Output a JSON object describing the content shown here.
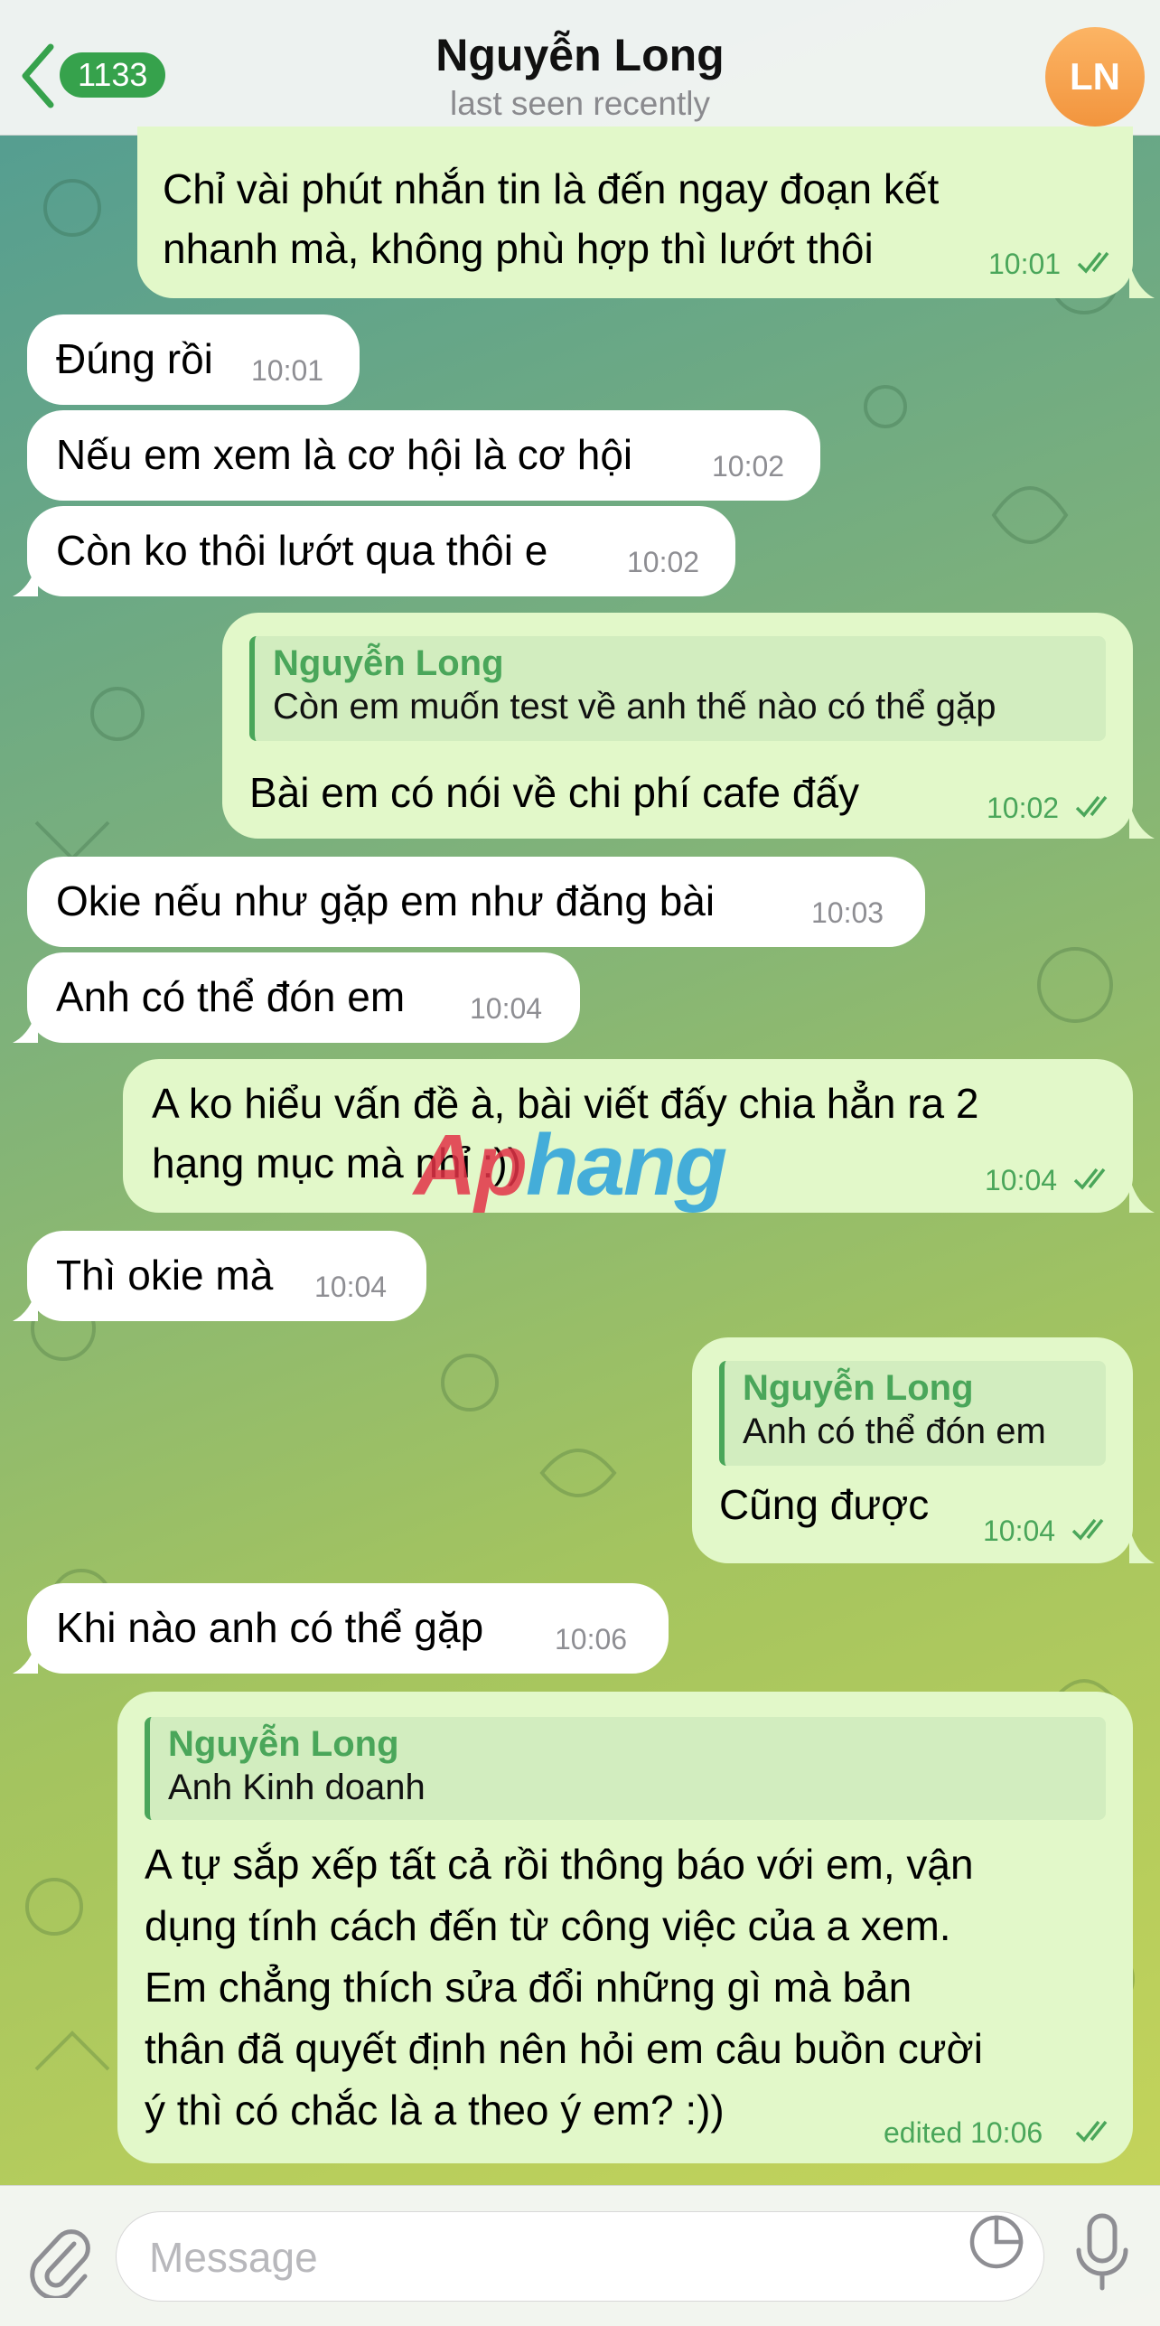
{
  "header": {
    "back_count": "1133",
    "title": "Nguyễn Long",
    "subtitle": "last seen recently",
    "avatar_initials": "LN",
    "avatar_color": "#f4a04a"
  },
  "messages": [
    {
      "dir": "out",
      "text": [
        "Chỉ vài phút nhắn tin là đến ngay đoạn kết",
        "nhanh mà, không phù hợp thì lướt thôi"
      ],
      "time": "10:01",
      "read": true
    },
    {
      "dir": "in",
      "text": [
        "Đúng rồi"
      ],
      "time": "10:01"
    },
    {
      "dir": "in",
      "text": [
        "Nếu em xem là cơ hội là cơ hội"
      ],
      "time": "10:02"
    },
    {
      "dir": "in",
      "text": [
        "Còn ko thôi lướt qua thôi e"
      ],
      "time": "10:02"
    },
    {
      "dir": "out",
      "reply_name": "Nguyễn Long",
      "reply_text": "Còn em muốn test về anh thế nào có thể gặp",
      "text": [
        "Bài em có nói về chi phí cafe đấy"
      ],
      "time": "10:02",
      "read": true
    },
    {
      "dir": "in",
      "text": [
        "Okie nếu như gặp em như đăng bài"
      ],
      "time": "10:03"
    },
    {
      "dir": "in",
      "text": [
        "Anh có thể đón em"
      ],
      "time": "10:04"
    },
    {
      "dir": "out",
      "text": [
        "A ko hiểu vấn đề à, bài viết đấy chia hẳn ra 2",
        "hạng mục mà nhỉ :))"
      ],
      "time": "10:04",
      "read": true
    },
    {
      "dir": "in",
      "text": [
        "Thì okie mà"
      ],
      "time": "10:04"
    },
    {
      "dir": "out",
      "reply_name": "Nguyễn Long",
      "reply_text": "Anh có thể đón em",
      "text": [
        "Cũng được"
      ],
      "time": "10:04",
      "read": true
    },
    {
      "dir": "in",
      "text": [
        "Khi nào anh có thể gặp"
      ],
      "time": "10:06"
    },
    {
      "dir": "out",
      "reply_name": "Nguyễn Long",
      "reply_text": "Anh Kinh doanh",
      "text": [
        "A tự sắp xếp tất cả rồi thông báo với em, vận",
        "dụng tính cách đến từ công việc của a xem.",
        "Em chẳng thích sửa đổi những gì mà bản",
        "thân đã quyết định nên hỏi em câu buồn cười",
        "ý thì có chắc là a theo ý em? :))"
      ],
      "time": "edited 10:06",
      "read": true
    }
  ],
  "watermark": {
    "part1": "Ap",
    "part2": "hang"
  },
  "input": {
    "placeholder": "Message"
  },
  "colors": {
    "accent": "#4aa65a",
    "outgoing_bubble": "#e2f8c9",
    "incoming_bubble": "#ffffff",
    "badge": "#36a24c"
  },
  "icons": [
    "back-chevron-icon",
    "paperclip-icon",
    "sticker-icon",
    "microphone-icon",
    "double-check-icon"
  ]
}
